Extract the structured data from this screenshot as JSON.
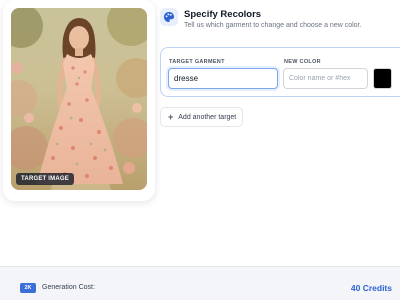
{
  "image_panel": {
    "badge_label": "TARGET IMAGE",
    "photo_icon": "photo-woman-floral-dress"
  },
  "header": {
    "icon": "palette-icon",
    "title": "Specify Recolors",
    "subtitle": "Tell us which garment to change and choose a new color."
  },
  "recolor": {
    "garment_label": "TARGET GARMENT",
    "garment_value": "dresse",
    "color_label": "NEW COLOR",
    "color_placeholder": "Color name or #hex",
    "color_value": "",
    "swatch_color": "#000000"
  },
  "add_target": {
    "icon": "plus-icon",
    "label": "Add another target"
  },
  "footer": {
    "quality": "2K",
    "cost_label": "Generation Cost:",
    "credits": "40 Credits"
  },
  "colors": {
    "accent": "#2f63d1",
    "badge_bg": "#3b6fd6",
    "input_focus_border": "#7aa7ee"
  }
}
